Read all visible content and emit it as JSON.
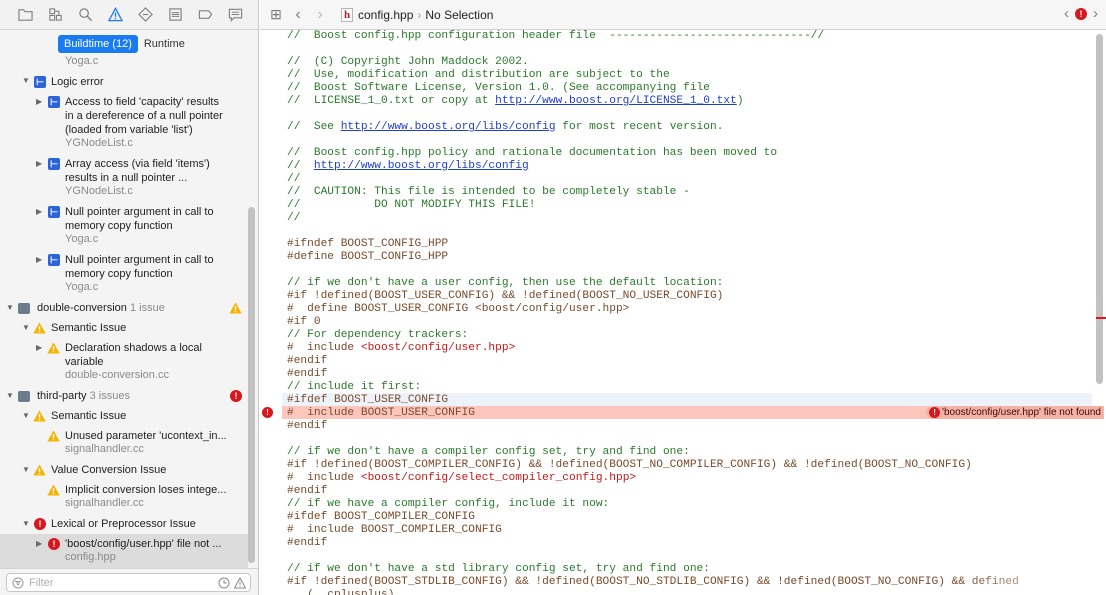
{
  "navigator": {
    "tabs": [
      {
        "label": "Buildtime (12)",
        "selected": true
      },
      {
        "label": "Runtime",
        "selected": false
      }
    ],
    "toolbar_icons": [
      "folder-icon",
      "source-control-icon",
      "find-icon",
      "issue-icon",
      "test-icon",
      "debug-icon",
      "breakpoint-icon",
      "report-icon",
      "log-icon"
    ],
    "top_cut_file": "Yoga.c",
    "groups": {
      "logic_error": {
        "label": "Logic error",
        "items": [
          {
            "lines": [
              "Access to field 'capacity' results",
              "in a dereference of a null pointer",
              "(loaded from variable 'list')"
            ],
            "file": "YGNodeList.c"
          },
          {
            "lines": [
              "Array access (via field 'items')",
              "results in a null pointer ..."
            ],
            "file": "YGNodeList.c"
          },
          {
            "lines": [
              "Null pointer argument in call to",
              "memory copy function"
            ],
            "file": "Yoga.c"
          },
          {
            "lines": [
              "Null pointer argument in call to",
              "memory copy function"
            ],
            "file": "Yoga.c"
          }
        ]
      },
      "double_conversion": {
        "label": "double-conversion",
        "count": "1 issue",
        "category": "Semantic Issue",
        "item": {
          "lines": [
            "Declaration shadows a local",
            "variable"
          ],
          "file": "double-conversion.cc"
        }
      },
      "third_party": {
        "label": "third-party",
        "count": "3 issues",
        "categories": [
          {
            "label": "Semantic Issue",
            "item": {
              "line": "Unused parameter 'ucontext_in...",
              "file": "signalhandler.cc"
            }
          },
          {
            "label": "Value Conversion Issue",
            "item": {
              "line": "Implicit conversion loses intege...",
              "file": "signalhandler.cc"
            }
          },
          {
            "label": "Lexical or Preprocessor Issue",
            "item": {
              "line": "'boost/config/user.hpp' file not ...",
              "file": "config.hpp"
            }
          }
        ]
      }
    },
    "filter_placeholder": "Filter"
  },
  "editor": {
    "file_name": "config.hpp",
    "selection": "No Selection",
    "error_message": "'boost/config/user.hpp' file not found",
    "code_lines": [
      [
        {
          "t": "//  Boost config.hpp configuration header file  ------------------------------//",
          "c": "cm"
        }
      ],
      [],
      [
        {
          "t": "//  (C) Copyright John Maddock 2002.",
          "c": "cm"
        }
      ],
      [
        {
          "t": "//  Use, modification and distribution are subject to the",
          "c": "cm"
        }
      ],
      [
        {
          "t": "//  Boost Software License, Version 1.0. (See accompanying file",
          "c": "cm"
        }
      ],
      [
        {
          "t": "//  LICENSE_1_0.txt or copy at ",
          "c": "cm"
        },
        {
          "t": "http://www.boost.org/LICENSE_1_0.txt",
          "c": "url"
        },
        {
          "t": ")",
          "c": "cm"
        }
      ],
      [],
      [
        {
          "t": "//  See ",
          "c": "cm"
        },
        {
          "t": "http://www.boost.org/libs/config",
          "c": "url"
        },
        {
          "t": " for most recent version.",
          "c": "cm"
        }
      ],
      [],
      [
        {
          "t": "//  Boost config.hpp policy and rationale documentation has been moved to",
          "c": "cm"
        }
      ],
      [
        {
          "t": "//  ",
          "c": "cm"
        },
        {
          "t": "http://www.boost.org/libs/config",
          "c": "url"
        }
      ],
      [
        {
          "t": "//",
          "c": "cm"
        }
      ],
      [
        {
          "t": "//  CAUTION: This file is intended to be completely stable -",
          "c": "cm"
        }
      ],
      [
        {
          "t": "//           DO NOT MODIFY THIS FILE!",
          "c": "cm"
        }
      ],
      [
        {
          "t": "//",
          "c": "cm"
        }
      ],
      [],
      [
        {
          "t": "#ifndef BOOST_CONFIG_HPP",
          "c": "pp"
        }
      ],
      [
        {
          "t": "#define BOOST_CONFIG_HPP",
          "c": "pp"
        }
      ],
      [],
      [
        {
          "t": "// if we don't have a user config, then use the default location:",
          "c": "cm"
        }
      ],
      [
        {
          "t": "#if !defined(BOOST_USER_CONFIG) && !defined(BOOST_NO_USER_CONFIG)",
          "c": "pp"
        }
      ],
      [
        {
          "t": "#  define BOOST_USER_CONFIG <boost/config/user.hpp>",
          "c": "pp"
        }
      ],
      [
        {
          "t": "#if 0",
          "c": "pp"
        }
      ],
      [
        {
          "t": "// For dependency trackers:",
          "c": "cm"
        }
      ],
      [
        {
          "t": "#  include ",
          "c": "pp"
        },
        {
          "t": "<boost/config/user.hpp>",
          "c": "str"
        }
      ],
      [
        {
          "t": "#endif",
          "c": "pp"
        }
      ],
      [
        {
          "t": "#endif",
          "c": "pp"
        }
      ],
      [
        {
          "t": "// include it first:",
          "c": "cm"
        }
      ],
      [
        {
          "t": "#ifdef BOOST_USER_CONFIG",
          "c": "pp"
        }
      ],
      [
        {
          "t": "#  include BOOST_USER_CONFIG",
          "c": "pp"
        }
      ],
      [
        {
          "t": "#endif",
          "c": "pp"
        }
      ],
      [],
      [
        {
          "t": "// if we don't have a compiler config set, try and find one:",
          "c": "cm"
        }
      ],
      [
        {
          "t": "#if !defined(BOOST_COMPILER_CONFIG) && !defined(BOOST_NO_COMPILER_CONFIG) && !defined(BOOST_NO_CONFIG)",
          "c": "pp"
        }
      ],
      [
        {
          "t": "#  include ",
          "c": "pp"
        },
        {
          "t": "<boost/config/select_compiler_config.hpp>",
          "c": "str"
        }
      ],
      [
        {
          "t": "#endif",
          "c": "pp"
        }
      ],
      [
        {
          "t": "// if we have a compiler config, include it now:",
          "c": "cm"
        }
      ],
      [
        {
          "t": "#ifdef BOOST_COMPILER_CONFIG",
          "c": "pp"
        }
      ],
      [
        {
          "t": "#  include BOOST_COMPILER_CONFIG",
          "c": "pp"
        }
      ],
      [
        {
          "t": "#endif",
          "c": "pp"
        }
      ],
      [],
      [
        {
          "t": "// if we don't have a std library config set, try and find one:",
          "c": "cm"
        }
      ],
      [
        {
          "t": "#if !defined(BOOST_STDLIB_CONFIG) && !defined(BOOST_NO_STDLIB_CONFIG) && !defined(BOOST_NO_CONFIG) && defined",
          "c": "pp"
        }
      ],
      [
        {
          "t": "   (__cplusplus)",
          "c": "pp"
        }
      ]
    ]
  },
  "colors": {
    "accent": "#1a7bf0",
    "error": "#d7161d",
    "warning": "#f5b400",
    "error_line_bg": "#fbc7bd",
    "comment": "#2a7a2a",
    "preprocessor": "#7a4a2a",
    "string": "#c41a16",
    "url": "#1f3fc8"
  }
}
